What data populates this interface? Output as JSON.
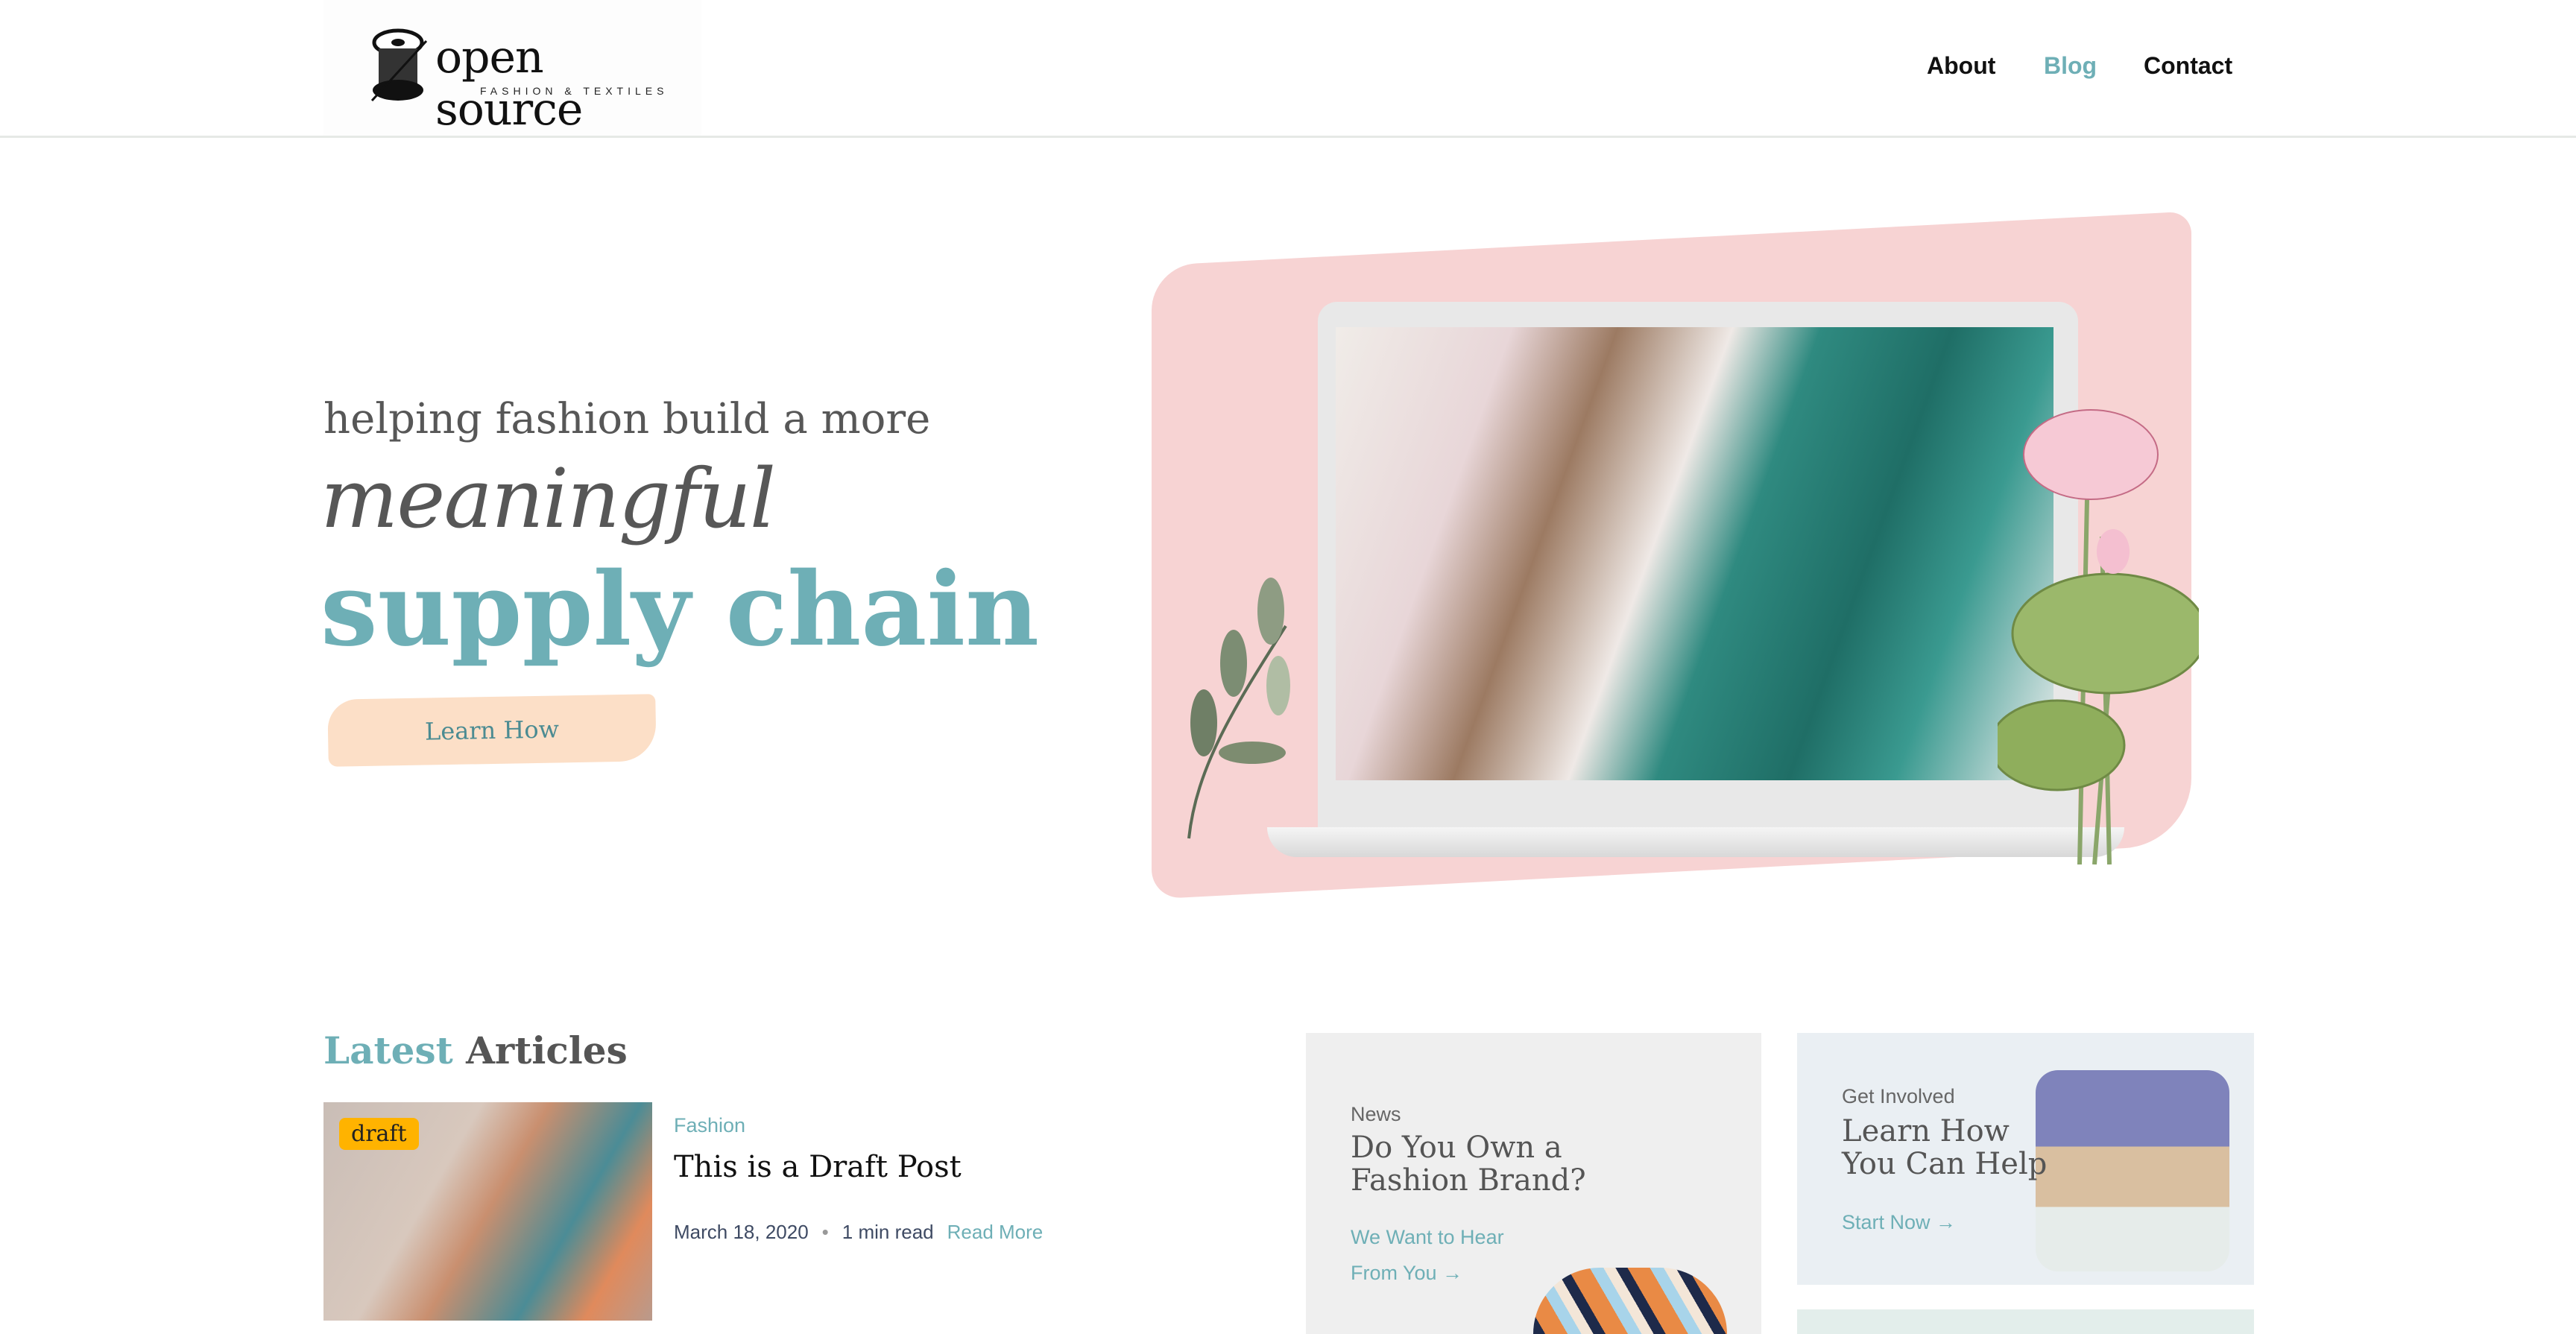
{
  "header": {
    "logo": {
      "main": "open source",
      "sub": "FASHION & TEXTILES"
    },
    "nav": [
      {
        "label": "About"
      },
      {
        "label": "Blog",
        "active": true
      },
      {
        "label": "Contact"
      }
    ]
  },
  "hero": {
    "tagline": "helping fashion build a more",
    "script_word": "meaningful",
    "headline": "supply chain",
    "cta": "Learn How"
  },
  "latest": {
    "heading_accent": "Latest",
    "heading_rest": "Articles",
    "articles": [
      {
        "badge": "draft",
        "category": "Fashion",
        "title": "This is a Draft Post",
        "date": "March 18, 2020",
        "read_time": "1 min read",
        "read_more": "Read More"
      }
    ]
  },
  "cards": [
    {
      "kicker": "News",
      "title_line1": "Do You Own a",
      "title_line2": "Fashion Brand?",
      "link_line1": "We Want to Hear",
      "link_line2": "From You →"
    },
    {
      "kicker": "Get Involved",
      "title_line1": "Learn How",
      "title_line2": "You Can Help",
      "link": "Start Now →"
    }
  ],
  "colors": {
    "accent": "#6eafb6",
    "cta_bg": "#fcdfc7",
    "draft_badge": "#ffb300",
    "hero_blob": "#f7d3d3"
  }
}
